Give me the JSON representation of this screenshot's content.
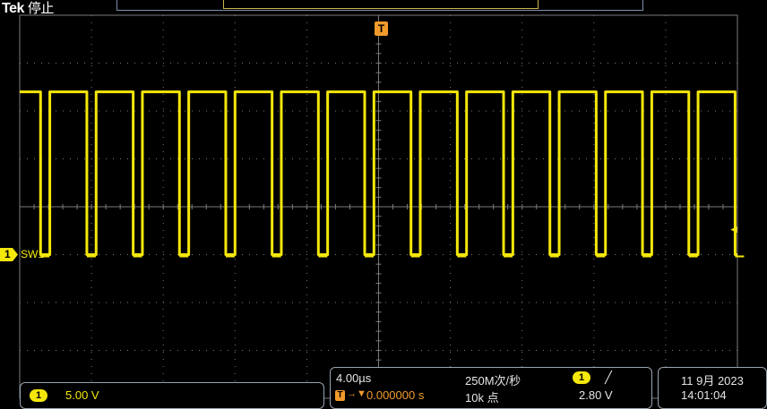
{
  "header": {
    "brand": "Tek",
    "acquisition_status": "停止"
  },
  "markers": {
    "trigger_position_icon": "T",
    "channel1_number": "1",
    "channel1_label": "SW1",
    "trigger_level_icon": "◄"
  },
  "channel_panel": {
    "channel_number": "1",
    "scale": "5.00 V"
  },
  "horizontal_panel": {
    "time_per_div": "4.00µs",
    "sample_rate": "250M次/秒",
    "trigger_icon": "T",
    "trigger_delay": "0.000000 s",
    "record_length": "10k 点",
    "trigger_source": "1",
    "trigger_slope": "╱",
    "trigger_level": "2.80 V"
  },
  "datetime_panel": {
    "date": "11 9月 2023",
    "time": "14:01:04"
  },
  "colors": {
    "channel1": "#f4e70a",
    "trigger": "#f29b2c",
    "grid": "#7a7a7a",
    "background": "#000000"
  },
  "chart_data": {
    "type": "line",
    "series": [
      {
        "name": "SW1",
        "waveform": "square",
        "cycles_on_screen": 15.5,
        "high_level_div": 2.4,
        "low_level_div": -1.0,
        "duty_cycle": 0.8
      }
    ],
    "x_divisions": 10,
    "y_divisions": 8,
    "grid": true
  }
}
